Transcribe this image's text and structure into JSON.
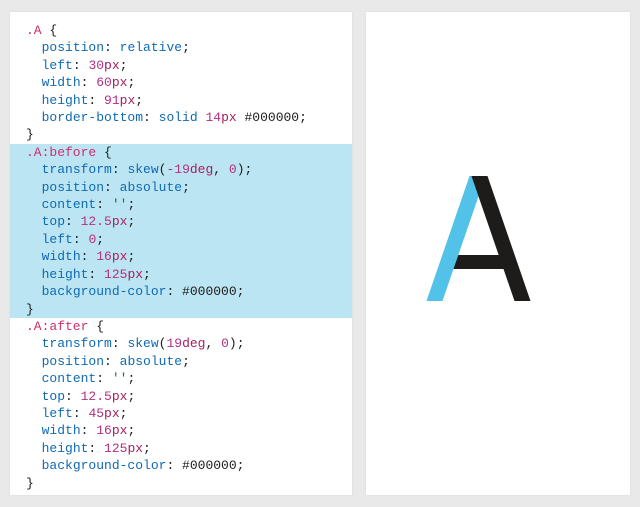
{
  "code": {
    "rules": [
      {
        "selector": ".A",
        "highlighted": false,
        "decls": [
          {
            "prop": "position",
            "value": "relative"
          },
          {
            "prop": "left",
            "value": "30px"
          },
          {
            "prop": "width",
            "value": "60px"
          },
          {
            "prop": "height",
            "value": "91px"
          },
          {
            "prop": "border-bottom",
            "value": "solid 14px #000000"
          }
        ]
      },
      {
        "selector": ".A:before",
        "highlighted": true,
        "decls": [
          {
            "prop": "transform",
            "value": "skew(-19deg, 0)"
          },
          {
            "prop": "position",
            "value": "absolute"
          },
          {
            "prop": "content",
            "value": "''"
          },
          {
            "prop": "top",
            "value": "12.5px"
          },
          {
            "prop": "left",
            "value": "0"
          },
          {
            "prop": "width",
            "value": "16px"
          },
          {
            "prop": "height",
            "value": "125px"
          },
          {
            "prop": "background-color",
            "value": "#000000"
          }
        ]
      },
      {
        "selector": ".A:after",
        "highlighted": false,
        "decls": [
          {
            "prop": "transform",
            "value": "skew(19deg, 0)"
          },
          {
            "prop": "position",
            "value": "absolute"
          },
          {
            "prop": "content",
            "value": "''"
          },
          {
            "prop": "top",
            "value": "12.5px"
          },
          {
            "prop": "left",
            "value": "45px"
          },
          {
            "prop": "width",
            "value": "16px"
          },
          {
            "prop": "height",
            "value": "125px"
          },
          {
            "prop": "background-color",
            "value": "#000000"
          }
        ]
      }
    ]
  },
  "preview": {
    "shape": "letter-A",
    "highlight_color": "#52c2e8",
    "base_color": "#1d1c1a"
  }
}
